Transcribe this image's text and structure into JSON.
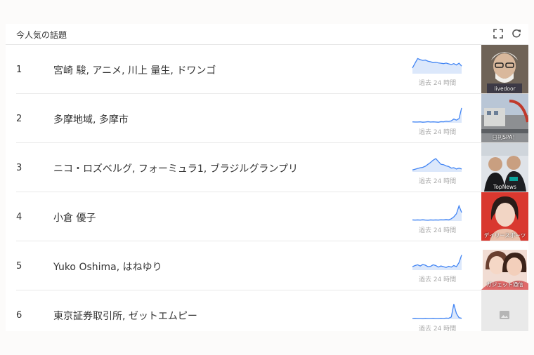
{
  "panel": {
    "title": "今人気の話題"
  },
  "icons": {
    "expand": "fullscreen-icon",
    "refresh": "refresh-icon",
    "image_placeholder": "image-icon"
  },
  "colors": {
    "accent": "#4285f4",
    "area": "#dce8fb"
  },
  "topics": [
    {
      "rank": "1",
      "names": "宮崎 駿, アニメ, 川上 量生, ドワンゴ",
      "time_label": "過去 24 時間",
      "source": "livedoor",
      "spark": [
        30,
        55,
        80,
        74,
        70,
        72,
        66,
        63,
        58,
        60,
        57,
        55,
        53,
        56,
        52,
        48,
        53,
        46,
        55,
        40
      ]
    },
    {
      "rank": "2",
      "names": "多摩地域, 多摩市",
      "time_label": "過去 24 時間",
      "source": "日刊SPA！",
      "spark": [
        5,
        4,
        4,
        5,
        3,
        4,
        6,
        4,
        5,
        4,
        3,
        6,
        5,
        8,
        7,
        10,
        20,
        14,
        22,
        78
      ]
    },
    {
      "rank": "3",
      "names": "ニコ・ロズベルグ, フォーミュラ1, ブラジルグランプリ",
      "time_label": "過去 24 時間",
      "source": "TopNews",
      "spark": [
        10,
        14,
        18,
        22,
        24,
        30,
        40,
        50,
        62,
        70,
        55,
        40,
        38,
        32,
        28,
        20,
        22,
        15,
        20,
        15
      ]
    },
    {
      "rank": "4",
      "names": "小倉 優子",
      "time_label": "過去 24 時間",
      "source": "デイリースポーツ",
      "spark": [
        6,
        5,
        6,
        5,
        7,
        5,
        4,
        6,
        5,
        6,
        5,
        7,
        6,
        8,
        6,
        12,
        22,
        38,
        80,
        45
      ]
    },
    {
      "rank": "5",
      "names": "Yuko Oshima, はねゆり",
      "time_label": "過去 24 時間",
      "source": "ガジェット通信",
      "spark": [
        18,
        24,
        28,
        22,
        30,
        26,
        18,
        20,
        28,
        24,
        16,
        22,
        18,
        14,
        20,
        16,
        24,
        18,
        40,
        80
      ]
    },
    {
      "rank": "6",
      "names": "東京証券取引所, ゼットエムピー",
      "time_label": "過去 24 時間",
      "source": "",
      "spark": [
        4,
        5,
        4,
        4,
        3,
        5,
        4,
        4,
        5,
        4,
        4,
        5,
        4,
        6,
        5,
        12,
        80,
        30,
        8,
        5
      ]
    }
  ]
}
